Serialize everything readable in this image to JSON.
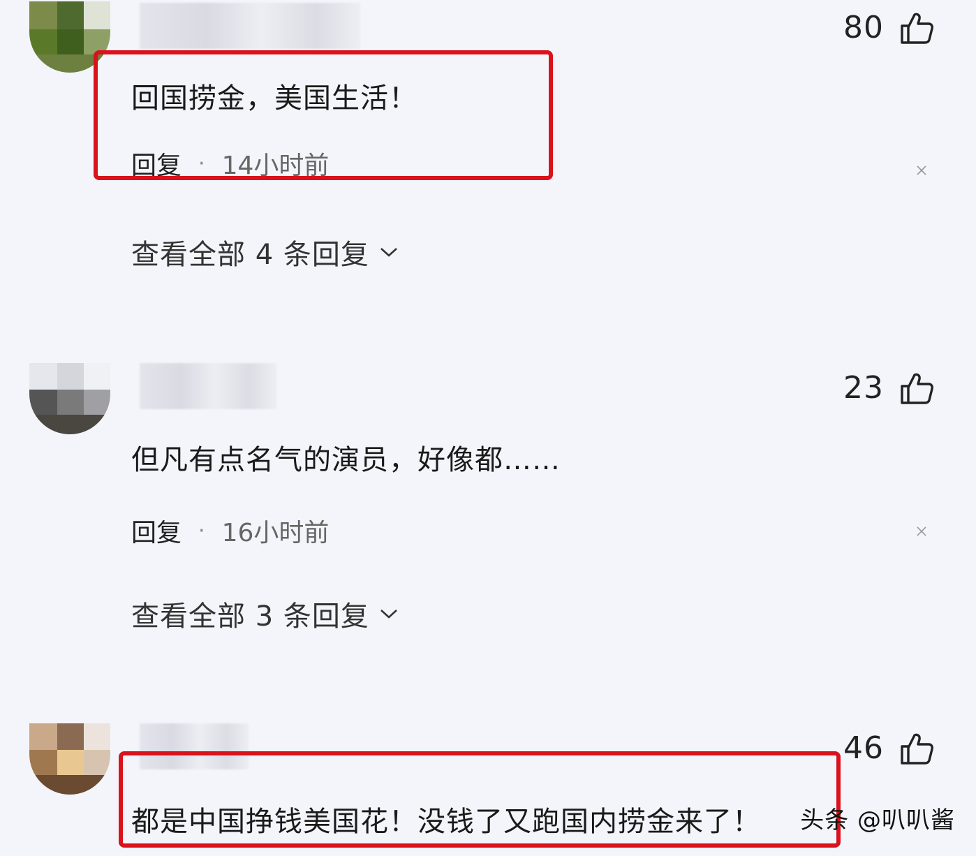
{
  "comments": [
    {
      "likes": "80",
      "text": "回国捞金，美国生活！",
      "reply_label": "回复",
      "separator": "·",
      "time": "14小时前",
      "expand_label": "查看全部 4 条回复"
    },
    {
      "likes": "23",
      "text": "但凡有点名气的演员，好像都……",
      "reply_label": "回复",
      "separator": "·",
      "time": "16小时前",
      "expand_label": "查看全部 3 条回复"
    },
    {
      "likes": "46",
      "text": "都是中国挣钱美国花！没钱了又跑国内捞金来了！"
    }
  ],
  "watermark": "头条 @叭叭酱",
  "colors": {
    "highlight": "#d9121b",
    "background": "#f4f5fa"
  }
}
